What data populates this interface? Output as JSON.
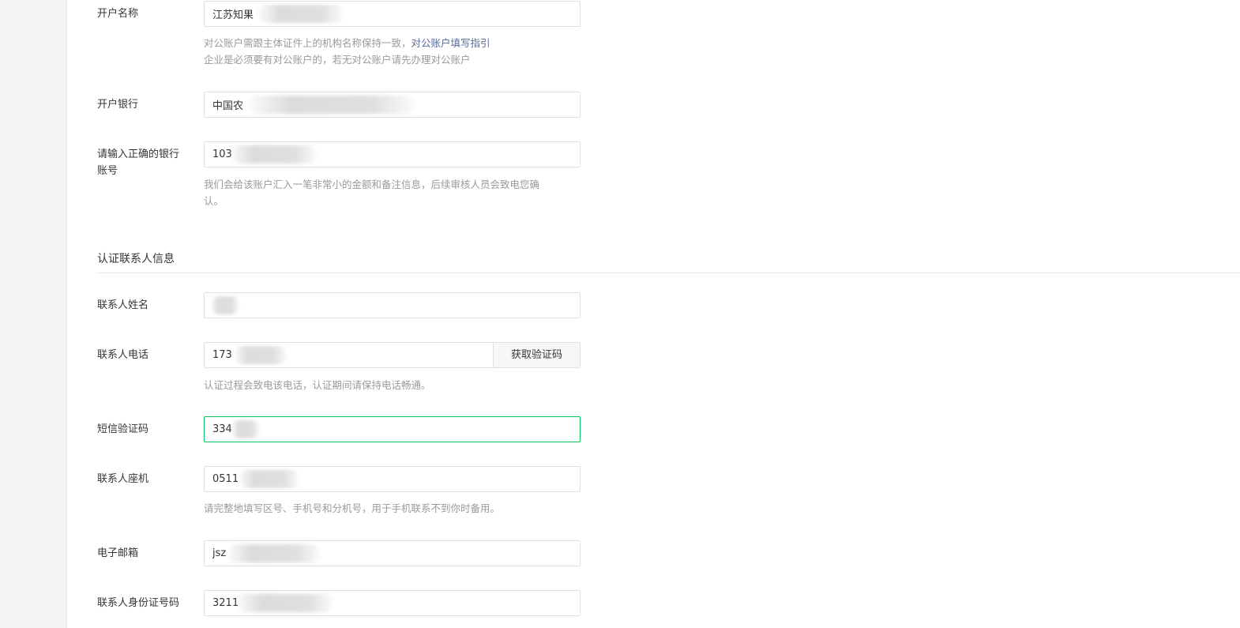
{
  "account": {
    "name_label": "开户名称",
    "name_value": "江苏知果",
    "name_tip_1": "对公账户需跟主体证件上的机构名称保持一致，",
    "name_tip_link": "对公账户填写指引",
    "name_tip_2": "企业是必须要有对公账户的，若无对公账户请先办理对公账户",
    "bank_label": "开户银行",
    "bank_value": "中国农",
    "number_label_1": "请输入正确的银行",
    "number_label_2": "账号",
    "number_value": "103",
    "number_tip_1": "我们会给该账户汇入一笔非常小的金额和备注信息，后续审核人员会致电您确",
    "number_tip_2": "认。"
  },
  "contact_section": {
    "title": "认证联系人信息"
  },
  "contact": {
    "name_label": "联系人姓名",
    "name_value": "",
    "phone_label": "联系人电话",
    "phone_value": "173",
    "get_code_button": "获取验证码",
    "phone_tip": "认证过程会致电该电话，认证期间请保持电话畅通。",
    "sms_label": "短信验证码",
    "sms_value": "334",
    "landline_label": "联系人座机",
    "landline_value": "0511",
    "landline_tip": "请完整地填写区号、手机号和分机号，用于手机联系不到你时备用。",
    "email_label": "电子邮箱",
    "email_value": "jsz",
    "id_label": "联系人身份证号码",
    "id_value": "3211"
  },
  "colors": {
    "accent_green": "#07c160",
    "link_blue": "#576b95",
    "tip_gray": "#9a9a9a"
  }
}
